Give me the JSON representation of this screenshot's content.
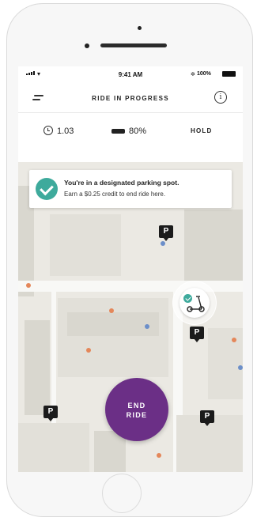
{
  "status_bar": {
    "time": "9:41 AM",
    "battery": "100%"
  },
  "nav": {
    "title": "RIDE IN PROGRESS"
  },
  "ride_stats": {
    "elapsed_time": "1.03",
    "scooter_battery": "80%",
    "hold_label": "HOLD"
  },
  "parking_toast": {
    "title": "You're in a designated parking spot.",
    "subtitle": "Earn a $0.25 credit to end ride here."
  },
  "map": {
    "parking_pin_label": "P"
  },
  "end_ride_button": {
    "line1": "END",
    "line2": "RIDE"
  },
  "colors": {
    "accent_purple": "#6b2f86",
    "success_teal": "#3eaa9c"
  },
  "icons": [
    "menu-icon",
    "info-icon",
    "clock-icon",
    "battery-icon",
    "check-icon",
    "scooter-icon",
    "parking-pin-icon"
  ]
}
